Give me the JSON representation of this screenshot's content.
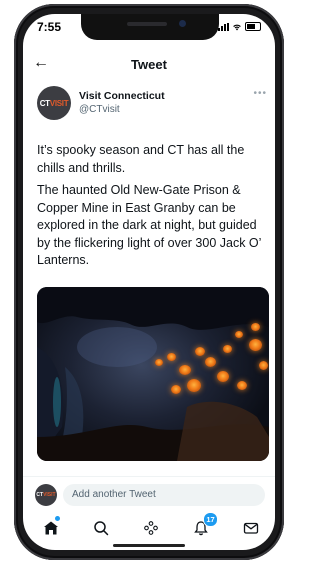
{
  "status_bar": {
    "time": "7:55"
  },
  "nav": {
    "title": "Tweet"
  },
  "author": {
    "avatar_text_prefix": "CT",
    "avatar_text_suffix": "VISIT",
    "name": "Visit Connecticut",
    "handle": "@CTvisit"
  },
  "tweet": {
    "paragraphs": [
      "It’s spooky season and CT has all the chills and thrills.",
      "The haunted Old New-Gate Prison & Copper Mine in East Granby can be explored in the dark at night, but guided by the flickering light of over 300 Jack O’ Lanterns."
    ]
  },
  "reply": {
    "placeholder": "Add another Tweet"
  },
  "tabbar": {
    "notifications_badge": "17",
    "accent": "#1d9bf0"
  },
  "icons": {
    "back": "back-arrow-icon",
    "more": "more-icon",
    "home": "home-icon",
    "search": "search-icon",
    "spaces": "spaces-icon",
    "notifications": "bell-icon",
    "messages": "mail-icon"
  }
}
